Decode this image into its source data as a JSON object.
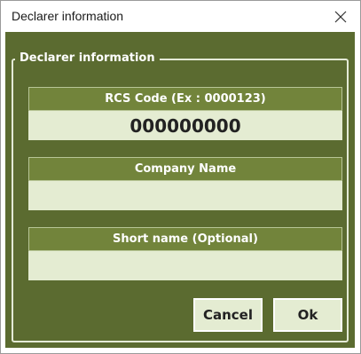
{
  "window": {
    "title": "Declarer information",
    "close_icon": "close-icon"
  },
  "group": {
    "legend": "Declarer information"
  },
  "fields": [
    {
      "label": "RCS Code (Ex : 0000123)",
      "value": "000000000",
      "placeholder": ""
    },
    {
      "label": "Company Name",
      "value": "",
      "placeholder": ""
    },
    {
      "label": "Short name (Optional)",
      "value": "",
      "placeholder": ""
    }
  ],
  "buttons": {
    "cancel": "Cancel",
    "ok": "Ok"
  },
  "colors": {
    "background": "#5b6b30",
    "header": "#72843b",
    "field": "#e4ecd2"
  }
}
